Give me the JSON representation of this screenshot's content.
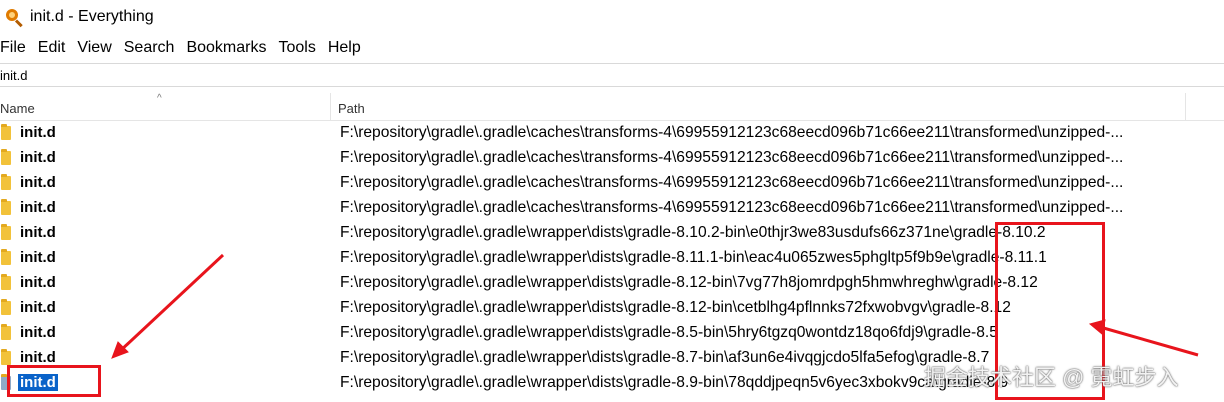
{
  "window": {
    "title": "init.d - Everything",
    "icon": "magnifier-icon"
  },
  "menu": [
    {
      "label": "File"
    },
    {
      "label": "Edit"
    },
    {
      "label": "View"
    },
    {
      "label": "Search"
    },
    {
      "label": "Bookmarks"
    },
    {
      "label": "Tools"
    },
    {
      "label": "Help"
    }
  ],
  "search": {
    "value": "init.d"
  },
  "columns": {
    "name": "Name",
    "path": "Path",
    "sort_indicator": "^"
  },
  "rows": [
    {
      "name": "init.d",
      "path": "F:\\repository\\gradle\\.gradle\\caches\\transforms-4\\69955912123c68eecd096b71c66ee211\\transformed\\unzipped-..."
    },
    {
      "name": "init.d",
      "path": "F:\\repository\\gradle\\.gradle\\caches\\transforms-4\\69955912123c68eecd096b71c66ee211\\transformed\\unzipped-..."
    },
    {
      "name": "init.d",
      "path": "F:\\repository\\gradle\\.gradle\\caches\\transforms-4\\69955912123c68eecd096b71c66ee211\\transformed\\unzipped-..."
    },
    {
      "name": "init.d",
      "path": "F:\\repository\\gradle\\.gradle\\caches\\transforms-4\\69955912123c68eecd096b71c66ee211\\transformed\\unzipped-..."
    },
    {
      "name": "init.d",
      "path": "F:\\repository\\gradle\\.gradle\\wrapper\\dists\\gradle-8.10.2-bin\\e0thjr3we83usdufs66z371ne\\gradle-8.10.2"
    },
    {
      "name": "init.d",
      "path": "F:\\repository\\gradle\\.gradle\\wrapper\\dists\\gradle-8.11.1-bin\\eac4u065zwes5phgltp5f9b9e\\gradle-8.11.1"
    },
    {
      "name": "init.d",
      "path": "F:\\repository\\gradle\\.gradle\\wrapper\\dists\\gradle-8.12-bin\\7vg77h8jomrdpgh5hmwhreghw\\gradle-8.12"
    },
    {
      "name": "init.d",
      "path": "F:\\repository\\gradle\\.gradle\\wrapper\\dists\\gradle-8.12-bin\\cetblhg4pflnnks72fxwobvgv\\gradle-8.12"
    },
    {
      "name": "init.d",
      "path": "F:\\repository\\gradle\\.gradle\\wrapper\\dists\\gradle-8.5-bin\\5hry6tgzq0wontdz18qo6fdj9\\gradle-8.5"
    },
    {
      "name": "init.d",
      "path": "F:\\repository\\gradle\\.gradle\\wrapper\\dists\\gradle-8.7-bin\\af3un6e4ivqgjcdo5lfa5efog\\gradle-8.7"
    },
    {
      "name": "init.d",
      "path": "F:\\repository\\gradle\\.gradle\\wrapper\\dists\\gradle-8.9-bin\\78qddjpeqn5v6yec3xbokv9ca\\gradle-8.9",
      "selected": true
    }
  ],
  "watermark": "掘金技术社区 @ 霓虹步入",
  "colors": {
    "selection": "#0a63c9",
    "annotation": "#e8141c",
    "folder": "#f2c23a"
  }
}
